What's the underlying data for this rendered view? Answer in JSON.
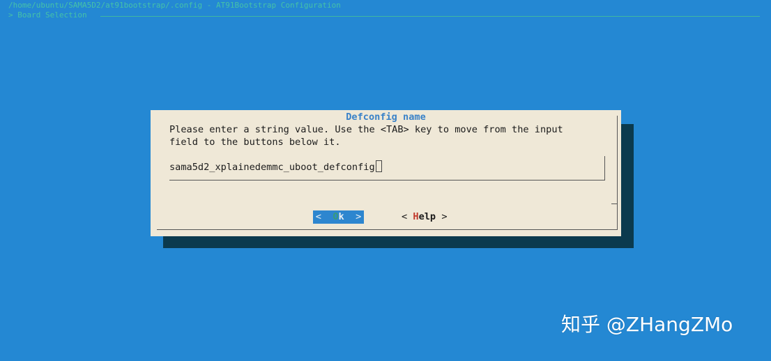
{
  "terminal": {
    "top_line_1": "/home/ubuntu/SAMA5D2/at91bootstrap/.config - AT91Bootstrap Configuration",
    "top_line_2": "> Board Selection",
    "colors": {
      "background": "#2488d3",
      "shadow": "#0b3a4e",
      "dialog": "#efe8d7",
      "title": "#3a82c8",
      "selected_button": "#2d86cf",
      "hotkey_help": "#c0392b"
    }
  },
  "dialog": {
    "title": "Defconfig name",
    "prompt_line_1": "Please enter a string value. Use the <TAB> key to move from the input",
    "prompt_line_2": "field to the buttons below it.",
    "input_value": "sama5d2_xplainedemmc_uboot_defconfig",
    "cursor_icon": "block-cursor-icon"
  },
  "buttons": {
    "ok": {
      "left_bracket": "<",
      "pre": " ",
      "hotkey": "O",
      "rest": "k",
      "post": " ",
      "right_bracket": ">",
      "selected": true
    },
    "help": {
      "left_bracket": "<",
      "pre": " ",
      "hotkey": "H",
      "rest": "elp",
      "post": " ",
      "right_bracket": ">",
      "selected": false
    }
  },
  "watermark": {
    "text": "知乎 @ZHangZMo"
  }
}
